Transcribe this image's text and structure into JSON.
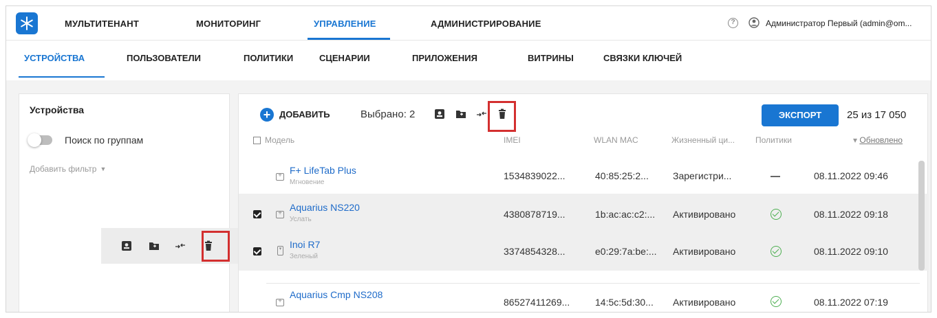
{
  "topnav": {
    "items": [
      {
        "label": "МУЛЬТИТЕНАНТ"
      },
      {
        "label": "МОНИТОРИНГ"
      },
      {
        "label": "УПРАВЛЕНИЕ"
      },
      {
        "label": "АДМИНИСТРИРОВАНИЕ"
      }
    ],
    "help_glyph": "?",
    "user_name": "Администратор Первый (admin@om..."
  },
  "subnav": {
    "items": [
      {
        "label": "УСТРОЙСТВА"
      },
      {
        "label": "ПОЛЬЗОВАТЕЛИ"
      },
      {
        "label": "ПОЛИТИКИ"
      },
      {
        "label": "СЦЕНАРИИ"
      },
      {
        "label": "ПРИЛОЖЕНИЯ"
      },
      {
        "label": "ВИТРИНЫ"
      },
      {
        "label": "СВЯЗКИ КЛЮЧЕЙ"
      }
    ]
  },
  "left_panel": {
    "title": "Устройства",
    "group_search_label": "Поиск по группам",
    "add_filter_label": "Добавить фильтр"
  },
  "toolbar": {
    "add_label": "ДОБАВИТЬ",
    "selected_label": "Выбрано: 2",
    "export_label": "ЭКСПОРТ",
    "count_label": "25 из 17 050"
  },
  "table": {
    "headers": {
      "model": "Модель",
      "imei": "IMEI",
      "wlan_mac": "WLAN MAC",
      "lifecycle": "Жизненный ци...",
      "policies": "Политики",
      "updated": "Обновлено"
    },
    "rows": [
      {
        "name": "F+ LifeTab Plus",
        "sub": "Мгновение",
        "imei": "1534839022...",
        "mac": "40:85:25:2...",
        "status": "Зарегистри...",
        "updated": "08.11.2022 09:46"
      },
      {
        "name": "Aquarius NS220",
        "sub": "Услать",
        "imei": "4380878719...",
        "mac": "1b:ac:ac:c2:...",
        "status": "Активировано",
        "updated": "08.11.2022 09:18"
      },
      {
        "name": "Inoi R7",
        "sub": "Зеленый",
        "imei": "3374854328...",
        "mac": "e0:29:7a:be:...",
        "status": "Активировано",
        "updated": "08.11.2022 09:10"
      },
      {
        "name": "Aquarius Cmp NS208",
        "sub": "",
        "imei": "86527411269...",
        "mac": "14:5c:5d:30...",
        "status": "Активировано",
        "updated": "08.11.2022 07:19"
      }
    ]
  },
  "colors": {
    "accent": "#1976d2",
    "highlight": "#d32f2f",
    "ok": "#4caf50"
  },
  "icons": [
    "logo-icon",
    "help-icon",
    "user-icon",
    "add-icon",
    "contact-card-icon",
    "folder-icon",
    "move-arrows-icon",
    "trash-icon",
    "checkbox-checked-icon",
    "tablet-icon",
    "phone-icon",
    "check-circle-icon",
    "sort-arrow-icon"
  ]
}
